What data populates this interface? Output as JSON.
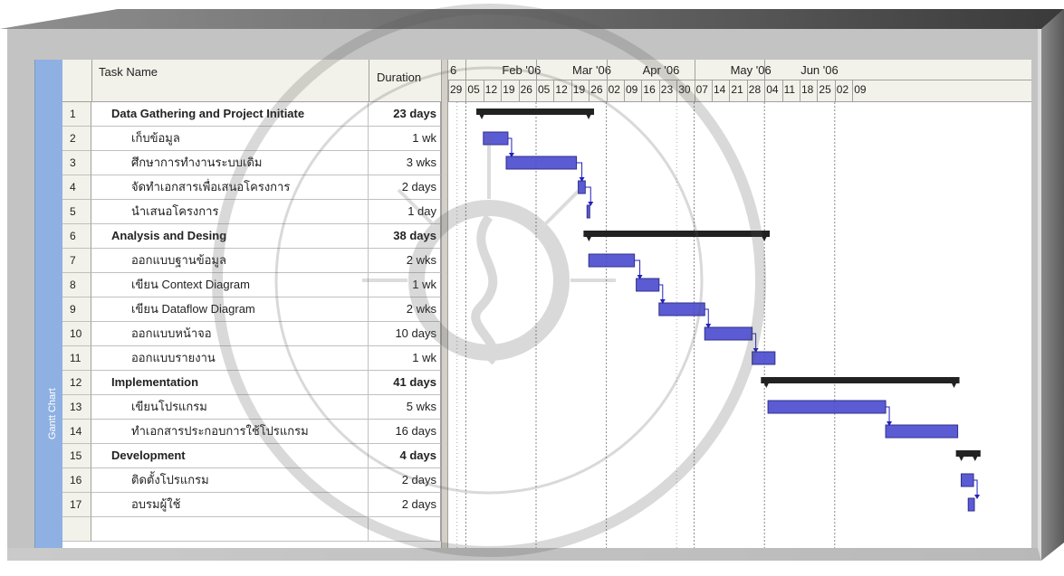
{
  "view_label": "Gantt Chart",
  "columns": {
    "task_name": "Task Name",
    "duration": "Duration"
  },
  "timescale": {
    "months": [
      "6",
      "Feb '06",
      "Mar '06",
      "Apr '06",
      "May '06",
      "Jun '06"
    ],
    "weeks": [
      "29",
      "05",
      "12",
      "19",
      "26",
      "05",
      "12",
      "19",
      "26",
      "02",
      "09",
      "16",
      "23",
      "30",
      "07",
      "14",
      "21",
      "28",
      "04",
      "11",
      "18",
      "25",
      "02",
      "09"
    ]
  },
  "tasks": [
    {
      "id": "1",
      "name": "Data Gathering and Project Initiate",
      "duration": "23 days",
      "summary": true
    },
    {
      "id": "2",
      "name": "เก็บข้อมูล",
      "duration": "1 wk",
      "summary": false
    },
    {
      "id": "3",
      "name": "ศึกษาการทำงานระบบเดิม",
      "duration": "3 wks",
      "summary": false
    },
    {
      "id": "4",
      "name": "จัดทำเอกสารเพื่อเสนอโครงการ",
      "duration": "2 days",
      "summary": false
    },
    {
      "id": "5",
      "name": "นำเสนอโครงการ",
      "duration": "1 day",
      "summary": false
    },
    {
      "id": "6",
      "name": "Analysis and Desing",
      "duration": "38 days",
      "summary": true
    },
    {
      "id": "7",
      "name": "ออกแบบฐานข้อมูล",
      "duration": "2 wks",
      "summary": false
    },
    {
      "id": "8",
      "name": "เขียน  Context Diagram",
      "duration": "1 wk",
      "summary": false
    },
    {
      "id": "9",
      "name": "เขียน  Dataflow  Diagram",
      "duration": "2 wks",
      "summary": false
    },
    {
      "id": "10",
      "name": "ออกแบบหน้าจอ",
      "duration": "10 days",
      "summary": false
    },
    {
      "id": "11",
      "name": "ออกแบบรายงาน",
      "duration": "1 wk",
      "summary": false
    },
    {
      "id": "12",
      "name": "Implementation",
      "duration": "41 days",
      "summary": true
    },
    {
      "id": "13",
      "name": "เขียนโปรแกรม",
      "duration": "5 wks",
      "summary": false
    },
    {
      "id": "14",
      "name": "ทำเอกสารประกอบการใช้โปรแกรม",
      "duration": "16 days",
      "summary": false
    },
    {
      "id": "15",
      "name": "Development",
      "duration": "4 days",
      "summary": true
    },
    {
      "id": "16",
      "name": "ติดตั้งโปรแกรม",
      "duration": "2 days",
      "summary": false
    },
    {
      "id": "17",
      "name": "อบรมผู้ใช้",
      "duration": "2 days",
      "summary": false
    }
  ],
  "colors": {
    "summary_bar": "#222222",
    "task_bar": "#4a4ad0",
    "link": "#2020c0",
    "header_bg": "#f2f2ea",
    "side_bar": "#8eb0e3"
  }
}
